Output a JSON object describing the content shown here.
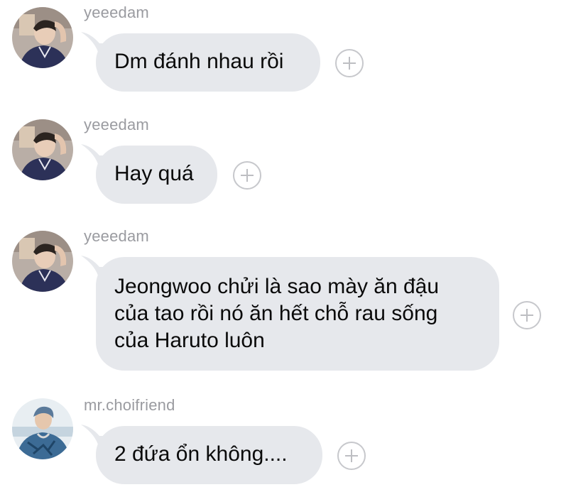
{
  "messages": [
    {
      "username": "yeeedam",
      "text": "Dm đánh nhau rồi",
      "avatar_icon": "profile-photo-icon",
      "react_icon": "add-reaction-icon"
    },
    {
      "username": "yeeedam",
      "text": "Hay quá",
      "avatar_icon": "profile-photo-icon",
      "react_icon": "add-reaction-icon"
    },
    {
      "username": "yeeedam",
      "text": "Jeongwoo chửi là sao mày ăn đậu\ncủa tao rồi nó ăn hết chỗ rau sống\ncủa Haruto luôn",
      "avatar_icon": "profile-photo-icon",
      "react_icon": "add-reaction-icon"
    },
    {
      "username": "mr.choifriend",
      "text": "2 đứa ổn không....",
      "avatar_icon": "profile-photo-icon",
      "react_icon": "add-reaction-icon"
    }
  ],
  "colors": {
    "bubble_bg": "#e6e8ec",
    "username": "#9a9ba0",
    "text": "#0a0a0a",
    "react_ring": "#c7c8cc"
  }
}
